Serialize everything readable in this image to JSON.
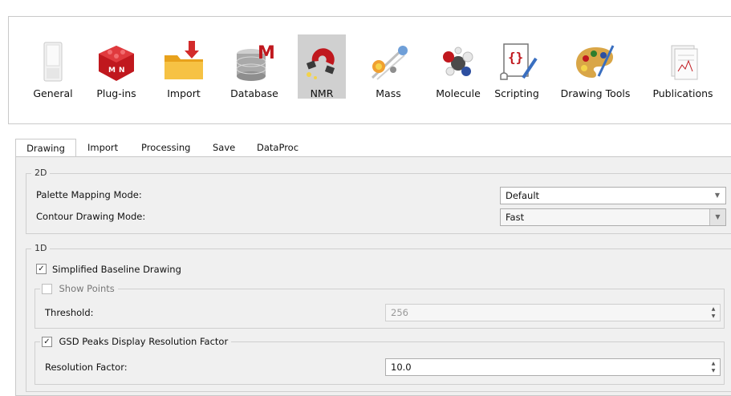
{
  "toolbar": {
    "items": [
      {
        "label": "General",
        "icon": "general-icon"
      },
      {
        "label": "Plug-ins",
        "icon": "plugins-icon"
      },
      {
        "label": "Import",
        "icon": "import-folder-icon"
      },
      {
        "label": "Database",
        "icon": "database-icon"
      },
      {
        "label": "NMR",
        "icon": "nmr-magnet-icon",
        "selected": true
      },
      {
        "label": "Mass",
        "icon": "mass-icon"
      },
      {
        "label": "Molecule",
        "icon": "molecule-icon"
      },
      {
        "label": "Scripting",
        "icon": "scripting-icon"
      },
      {
        "label": "Drawing Tools",
        "icon": "palette-icon"
      },
      {
        "label": "Publications",
        "icon": "publications-icon"
      }
    ]
  },
  "tabs": [
    "Drawing",
    "Import",
    "Processing",
    "Save",
    "DataProc"
  ],
  "active_tab": "Drawing",
  "group_2d": {
    "title": "2D",
    "palette_label": "Palette Mapping Mode:",
    "palette_value": "Default",
    "contour_label": "Contour Drawing Mode:",
    "contour_value": "Fast"
  },
  "group_1d": {
    "title": "1D",
    "simplified_label": "Simplified Baseline Drawing",
    "simplified_checked": true,
    "show_points_label": "Show Points",
    "show_points_checked": false,
    "threshold_label": "Threshold:",
    "threshold_value": "256",
    "gsd_label": "GSD Peaks Display Resolution Factor",
    "gsd_checked": true,
    "resolution_label": "Resolution Factor:",
    "resolution_value": "10.0"
  },
  "glyphs": {
    "check": "✓",
    "down": "▼",
    "up": "▲"
  }
}
